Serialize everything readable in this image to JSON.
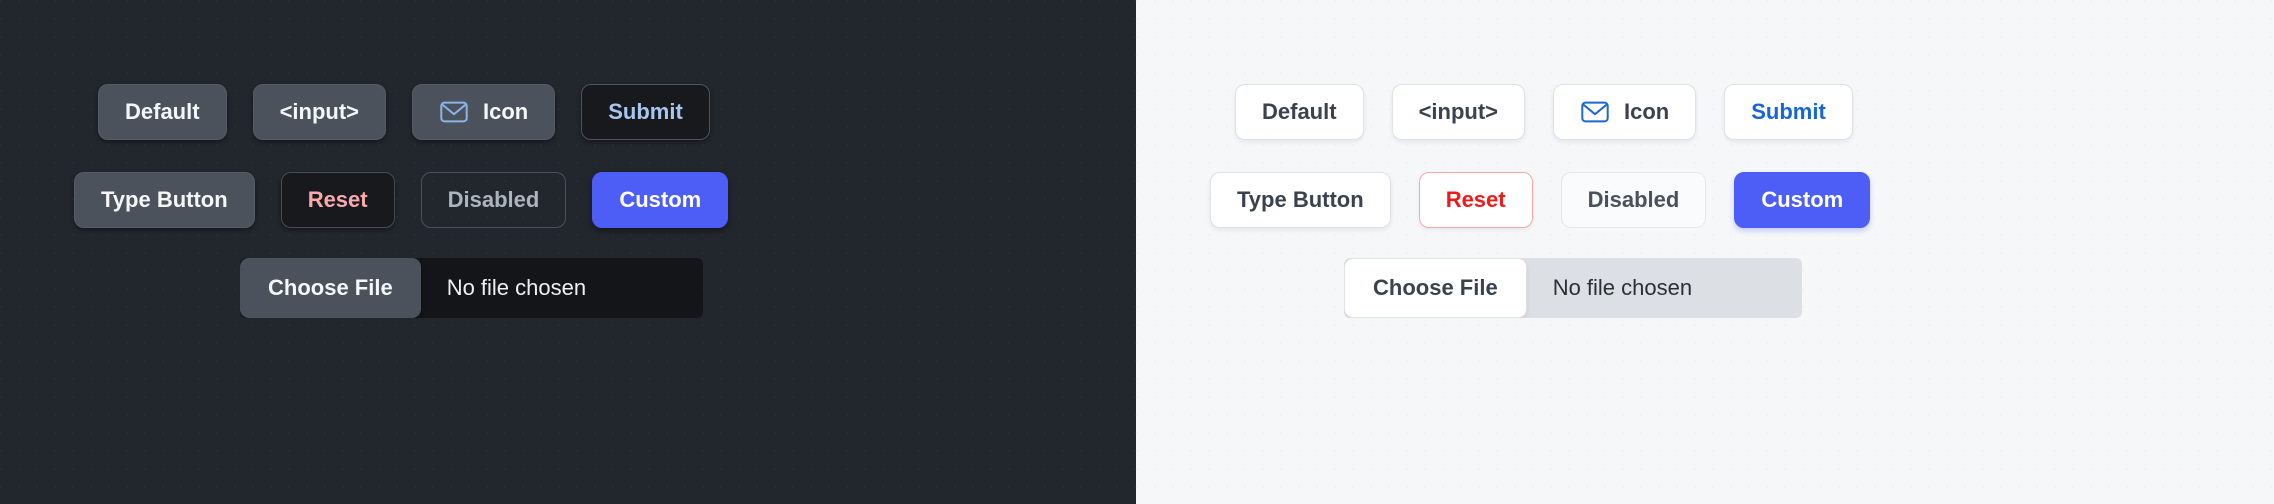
{
  "panels": {
    "dark": {
      "theme_name": "dark",
      "background_color": "#22262d",
      "rows": {
        "row1": {
          "default_label": "Default",
          "input_label": "<input>",
          "icon_label": "Icon",
          "icon_name": "envelope-icon",
          "icon_color": "#8bb4e6",
          "submit_label": "Submit",
          "submit_color": "#a8c6ef"
        },
        "row2": {
          "type_button_label": "Type Button",
          "reset_label": "Reset",
          "reset_color": "#f8a9ac",
          "disabled_label": "Disabled",
          "disabled_color": "#aeb4bd",
          "custom_label": "Custom",
          "custom_bg": "#4c5ef5"
        },
        "row3": {
          "choose_file_label": "Choose File",
          "file_status_label": "No file chosen"
        }
      }
    },
    "light": {
      "theme_name": "light",
      "background_color": "#f6f7f9",
      "rows": {
        "row1": {
          "default_label": "Default",
          "input_label": "<input>",
          "icon_label": "Icon",
          "icon_name": "envelope-icon",
          "icon_color": "#1e66d0",
          "submit_label": "Submit",
          "submit_color": "#1565d8"
        },
        "row2": {
          "type_button_label": "Type Button",
          "reset_label": "Reset",
          "reset_color": "#f11a1a",
          "reset_border": "#f9a8a8",
          "disabled_label": "Disabled",
          "disabled_color": "#4a515b",
          "custom_label": "Custom",
          "custom_bg": "#4c5ef5"
        },
        "row3": {
          "choose_file_label": "Choose File",
          "file_status_label": "No file chosen"
        }
      }
    }
  }
}
